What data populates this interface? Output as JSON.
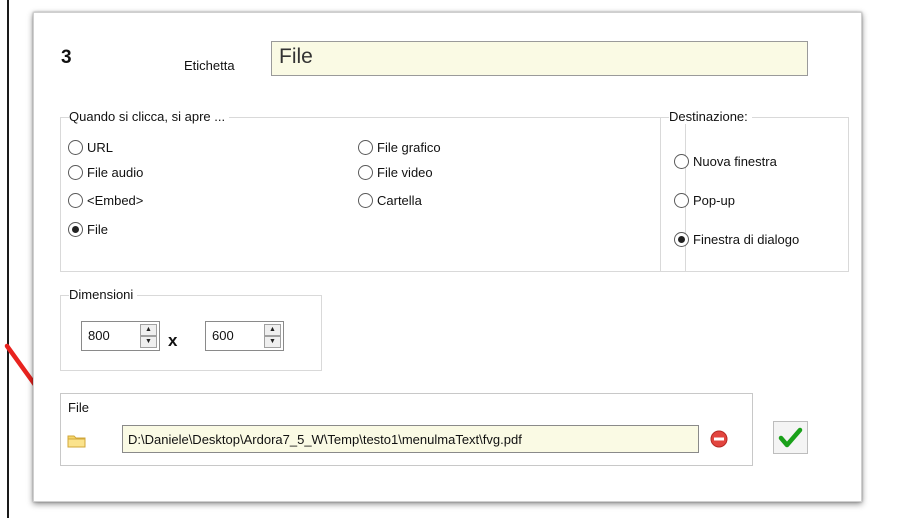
{
  "header": {
    "item_number": "3",
    "label_caption": "Etichetta",
    "label_value": "File"
  },
  "opens": {
    "title": "Quando si clicca, si apre ...",
    "options": [
      {
        "label": "URL",
        "selected": false
      },
      {
        "label": "File audio",
        "selected": false
      },
      {
        "label": "<Embed>",
        "selected": false
      },
      {
        "label": "File",
        "selected": true
      },
      {
        "label": "File grafico",
        "selected": false
      },
      {
        "label": "File video",
        "selected": false
      },
      {
        "label": "Cartella",
        "selected": false
      }
    ]
  },
  "destination": {
    "title": "Destinazione:",
    "options": [
      {
        "label": "Nuova finestra",
        "selected": false
      },
      {
        "label": "Pop-up",
        "selected": false
      },
      {
        "label": "Finestra di dialogo",
        "selected": true
      }
    ]
  },
  "dimensions": {
    "title": "Dimensioni",
    "width": "800",
    "separator": "x",
    "height": "600"
  },
  "file": {
    "title": "File",
    "path": "D:\\Daniele\\Desktop\\Ardora7_5_W\\Temp\\testo1\\menulmaText\\fvg.pdf",
    "folder_icon": "folder-icon",
    "remove_icon": "remove-icon"
  },
  "confirm": {
    "icon": "checkmark-icon",
    "color": "#1aa11a"
  },
  "annotation": {
    "arrow_color": "#e8231f"
  }
}
